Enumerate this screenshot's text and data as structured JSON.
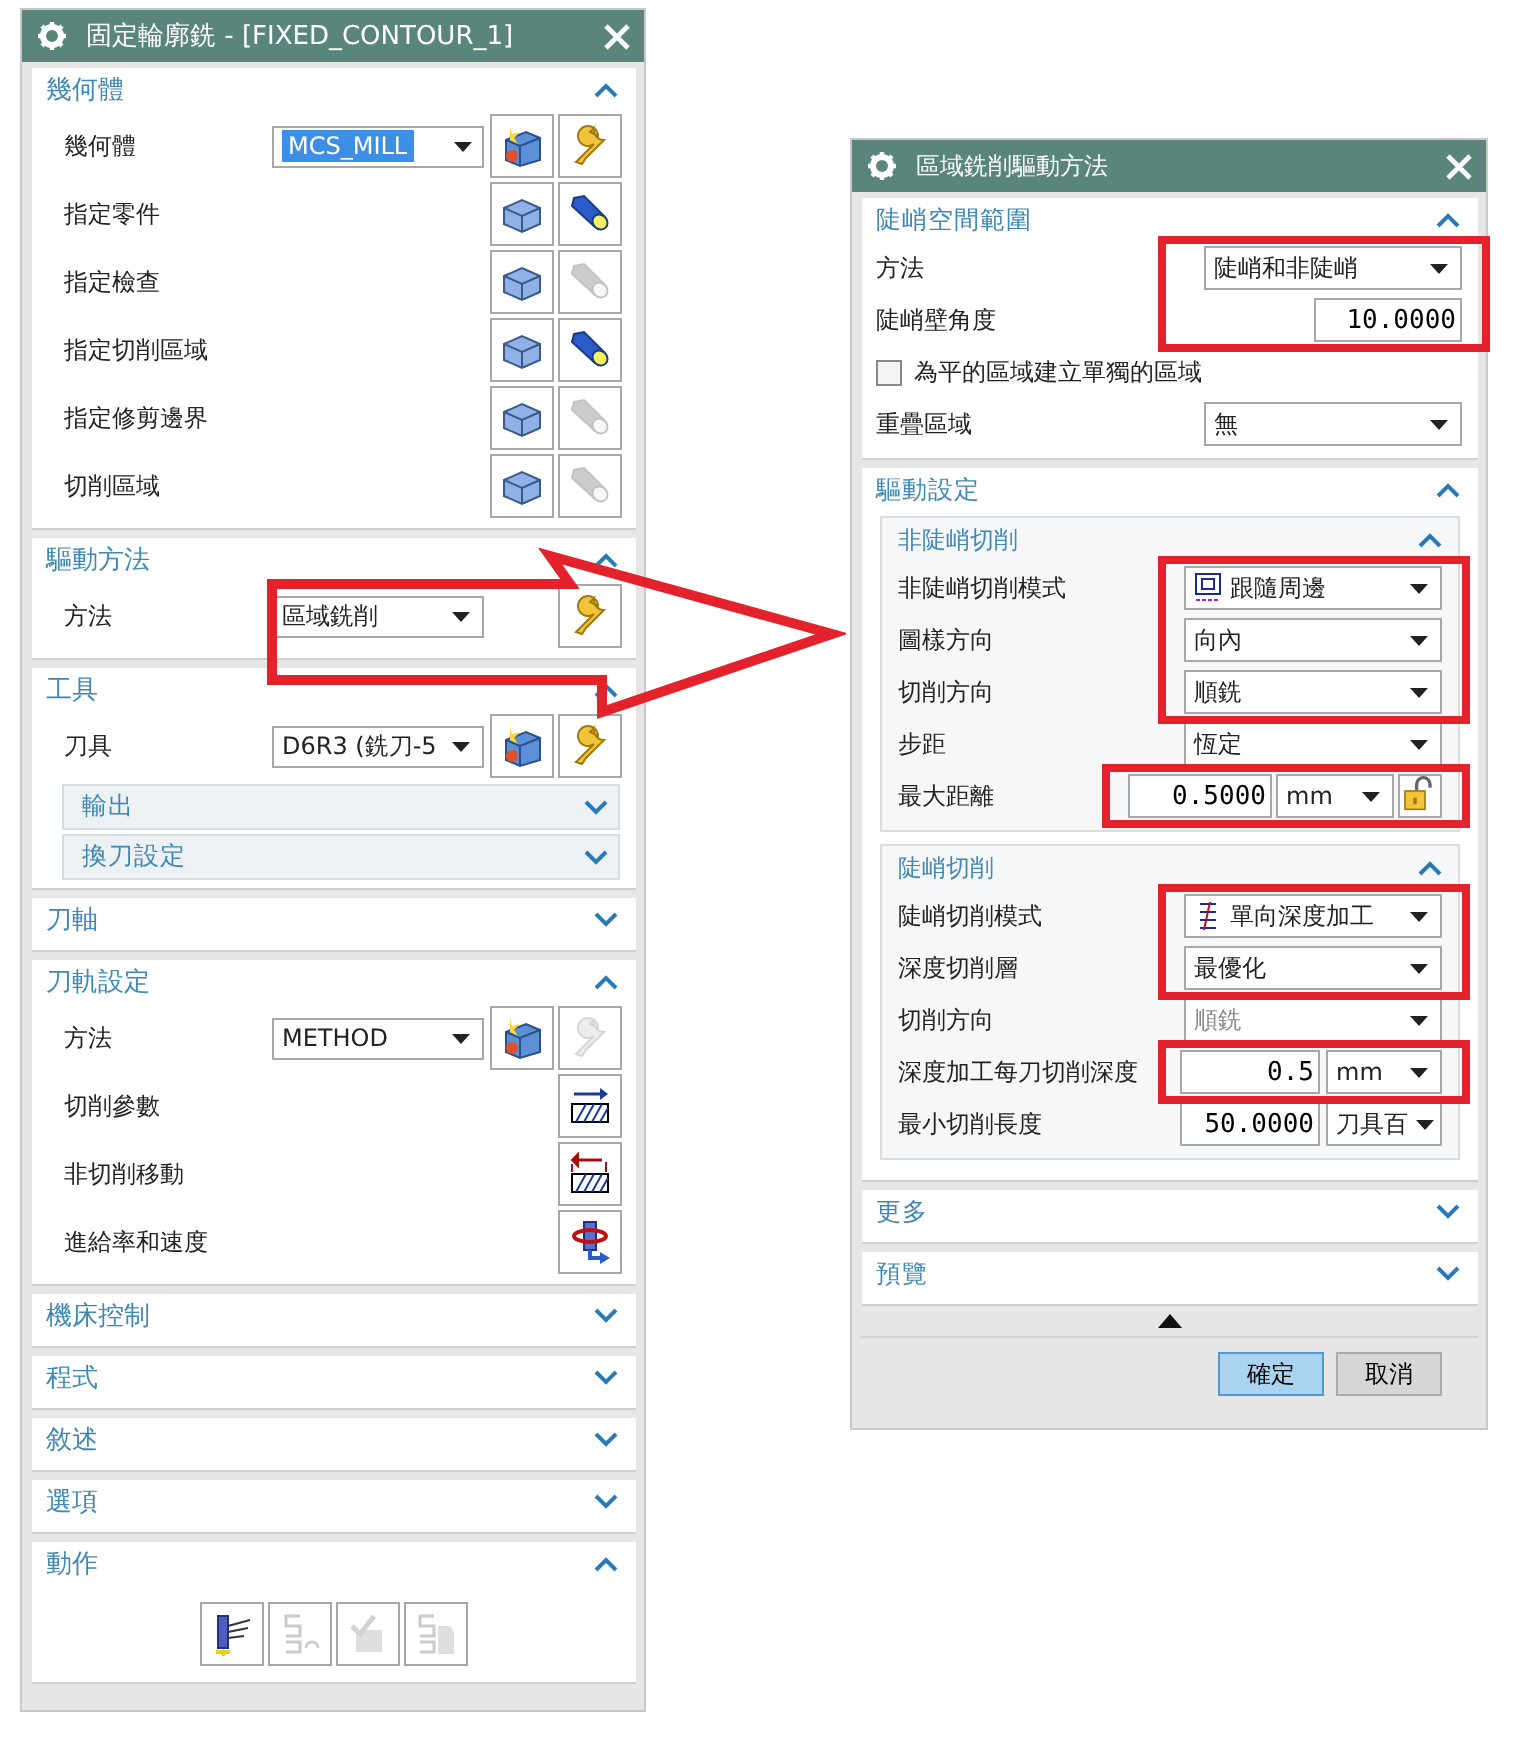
{
  "dialogs": [
    {
      "title": "固定輪廓銑 - [FIXED_CONTOUR_1]",
      "sections": [
        {
          "title": "幾何體",
          "expanded": true,
          "rows": [
            {
              "kind": "select",
              "label": "幾何體",
              "value": "MCS_MILL",
              "value_selected": true,
              "buttons": [
                {
                  "kind": "create",
                  "disabled": false
                },
                {
                  "kind": "edit",
                  "disabled": false
                }
              ]
            },
            {
              "kind": "action",
              "label": "指定零件",
              "buttons": [
                {
                  "kind": "specify",
                  "disabled": false
                },
                {
                  "kind": "display",
                  "disabled": false
                }
              ]
            },
            {
              "kind": "action",
              "label": "指定檢查",
              "buttons": [
                {
                  "kind": "specify",
                  "disabled": false
                },
                {
                  "kind": "display",
                  "disabled": true
                }
              ]
            },
            {
              "kind": "action",
              "label": "指定切削區域",
              "buttons": [
                {
                  "kind": "specify",
                  "disabled": false
                },
                {
                  "kind": "display",
                  "disabled": false
                }
              ]
            },
            {
              "kind": "action",
              "label": "指定修剪邊界",
              "buttons": [
                {
                  "kind": "specify",
                  "disabled": false
                },
                {
                  "kind": "display",
                  "disabled": true
                }
              ]
            },
            {
              "kind": "action",
              "label": "切削區域",
              "buttons": [
                {
                  "kind": "specify",
                  "disabled": false
                },
                {
                  "kind": "display",
                  "disabled": true
                }
              ]
            }
          ]
        },
        {
          "title": "驅動方法",
          "expanded": true,
          "rows": [
            {
              "kind": "select",
              "label": "方法",
              "value": "區域銑削",
              "value_selected": false,
              "buttons": [
                {
                  "kind": "edit",
                  "disabled": false
                }
              ]
            }
          ]
        },
        {
          "title": "工具",
          "expanded": true,
          "rows": [
            {
              "kind": "select",
              "label": "刀具",
              "value": "D6R3 (銑刀-5",
              "value_selected": false,
              "buttons": [
                {
                  "kind": "create",
                  "disabled": false
                },
                {
                  "kind": "edit",
                  "disabled": false
                }
              ]
            },
            {
              "kind": "subsection",
              "label": "輸出",
              "expanded": false
            },
            {
              "kind": "subsection",
              "label": "換刀設定",
              "expanded": false
            }
          ]
        },
        {
          "title": "刀軸",
          "expanded": false
        },
        {
          "title": "刀軌設定",
          "expanded": true,
          "rows": [
            {
              "kind": "select",
              "label": "方法",
              "value": "METHOD",
              "value_selected": false,
              "buttons": [
                {
                  "kind": "create",
                  "disabled": false
                },
                {
                  "kind": "edit",
                  "disabled": true
                }
              ]
            },
            {
              "kind": "action",
              "label": "切削參數",
              "buttons": [
                {
                  "kind": "cut-params",
                  "disabled": false
                }
              ]
            },
            {
              "kind": "action",
              "label": "非切削移動",
              "buttons": [
                {
                  "kind": "non-cut",
                  "disabled": false
                }
              ]
            },
            {
              "kind": "action",
              "label": "進給率和速度",
              "buttons": [
                {
                  "kind": "feeds",
                  "disabled": false
                }
              ]
            }
          ]
        },
        {
          "title": "機床控制",
          "expanded": false
        },
        {
          "title": "程式",
          "expanded": false
        },
        {
          "title": "敘述",
          "expanded": false
        },
        {
          "title": "選項",
          "expanded": false
        },
        {
          "title": "動作",
          "expanded": true,
          "rows": [
            {
              "kind": "toolbar",
              "buttons": [
                {
                  "kind": "generate",
                  "disabled": false
                },
                {
                  "kind": "replay",
                  "disabled": true
                },
                {
                  "kind": "verify",
                  "disabled": true
                },
                {
                  "kind": "list",
                  "disabled": true
                }
              ]
            }
          ]
        }
      ]
    },
    {
      "title": "區域銑削驅動方法",
      "sections": [
        {
          "title": "陡峭空間範圍",
          "expanded": true,
          "rows": [
            {
              "kind": "select",
              "label": "方法",
              "value": "陡峭和非陡峭",
              "highlight": true
            },
            {
              "kind": "number",
              "label": "陡峭壁角度",
              "value": "10.0000",
              "highlight": true
            },
            {
              "kind": "checkbox",
              "label": "為平的區域建立單獨的區域",
              "checked": false
            },
            {
              "kind": "select",
              "label": "重疊區域",
              "value": "無"
            }
          ]
        },
        {
          "title": "驅動設定",
          "expanded": true,
          "rows": [
            {
              "kind": "group",
              "label": "非陡峭切削",
              "expanded": true,
              "rows": [
                {
                  "kind": "patternselect",
                  "label": "非陡峭切削模式",
                  "value": "跟隨周邊",
                  "highlight": true
                },
                {
                  "kind": "select",
                  "label": "圖樣方向",
                  "value": "向內",
                  "highlight": true
                },
                {
                  "kind": "select",
                  "label": "切削方向",
                  "value": "順銑",
                  "highlight": true
                },
                {
                  "kind": "select",
                  "label": "步距",
                  "value": "恆定"
                },
                {
                  "kind": "number-unit",
                  "label": "最大距離",
                  "value": "0.5000",
                  "unit": "mm",
                  "lock": true,
                  "highlight": true
                }
              ]
            },
            {
              "kind": "group",
              "label": "陡峭切削",
              "expanded": true,
              "rows": [
                {
                  "kind": "layerselect",
                  "label": "陡峭切削模式",
                  "value": "單向深度加工",
                  "highlight": true
                },
                {
                  "kind": "select",
                  "label": "深度切削層",
                  "value": "最優化",
                  "highlight": true
                },
                {
                  "kind": "select",
                  "label": "切削方向",
                  "value": "順銑",
                  "disabled": true
                },
                {
                  "kind": "number-unit",
                  "label": "深度加工每刀切削深度",
                  "value": "0.5",
                  "unit": "mm",
                  "highlight": true
                },
                {
                  "kind": "number-unit",
                  "label": "最小切削長度",
                  "value": "50.0000",
                  "unit": "刀具百"
                }
              ]
            }
          ]
        },
        {
          "title": "更多",
          "expanded": false
        },
        {
          "title": "預覽",
          "expanded": false
        }
      ],
      "footer": {
        "buttons": [
          {
            "label": "確定",
            "default": true
          },
          {
            "label": "取消",
            "default": false
          }
        ]
      }
    }
  ]
}
